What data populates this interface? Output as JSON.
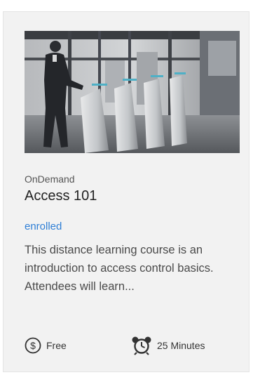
{
  "course": {
    "category": "OnDemand",
    "title": "Access 101",
    "status": "enrolled",
    "description": "This distance learning course is an introduction to access control basics. Attendees will learn...",
    "price": {
      "icon": "dollar-circle-icon",
      "label": "Free"
    },
    "duration": {
      "icon": "alarm-clock-icon",
      "label": "25 Minutes"
    }
  },
  "colors": {
    "card_background": "#f2f2f2",
    "status_link": "#2f7fd6",
    "text_primary": "#222222",
    "text_secondary": "#4a4a4a"
  }
}
